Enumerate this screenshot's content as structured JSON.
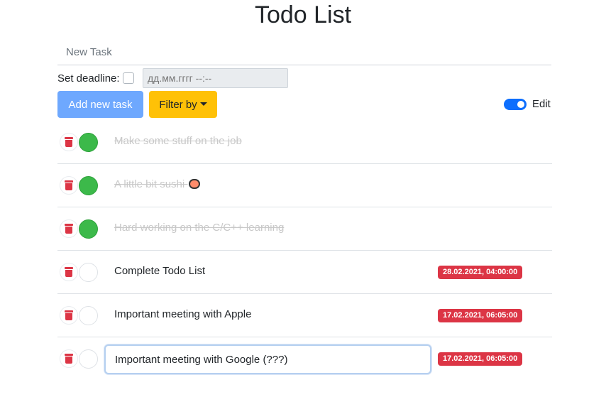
{
  "app": {
    "title": "Todo List"
  },
  "new_task": {
    "placeholder": "New Task",
    "value": ""
  },
  "deadline": {
    "label": "Set deadline:",
    "checked": false,
    "placeholder": "дд.мм.гггг --:--"
  },
  "toolbar": {
    "add_label": "Add new task",
    "filter_label": "Filter by",
    "edit_label": "Edit",
    "edit_enabled": true
  },
  "tasks": [
    {
      "text": "Make some stuff on the job",
      "done": true,
      "deadline": ""
    },
    {
      "text": "A little bit sushi",
      "done": true,
      "deadline": "",
      "emoji": "sushi"
    },
    {
      "text": "Hard working on the C/C++ learning",
      "done": true,
      "deadline": ""
    },
    {
      "text": "Complete Todo List",
      "done": false,
      "deadline": "28.02.2021, 04:00:00"
    },
    {
      "text": "Important meeting with Apple",
      "done": false,
      "deadline": "17.02.2021, 06:05:00"
    },
    {
      "text": "Important meeting with Google (???)",
      "done": false,
      "deadline": "17.02.2021, 06:05:00",
      "editing": true
    }
  ],
  "colors": {
    "accent": "#0d6efd",
    "add_button": "#6ea8fe",
    "filter_button": "#ffc107",
    "done": "#3cb94a",
    "danger": "#dc3545"
  }
}
